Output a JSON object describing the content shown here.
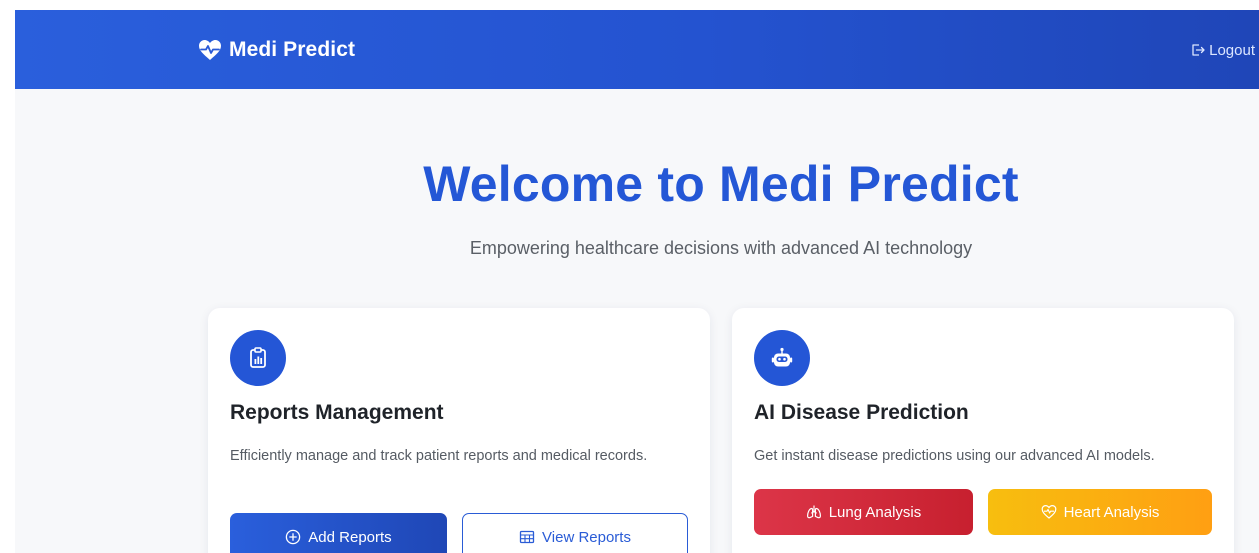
{
  "navbar": {
    "brand": "Medi Predict",
    "brand_icon": "heart-pulse-icon",
    "logout_label": "Logout",
    "logout_icon": "logout-icon"
  },
  "hero": {
    "title": "Welcome to Medi Predict",
    "subtitle": "Empowering healthcare decisions with advanced AI technology"
  },
  "cards": [
    {
      "icon": "clipboard-chart-icon",
      "title": "Reports Management",
      "description": "Efficiently manage and track patient reports and medical records.",
      "buttons": [
        {
          "label": "Add Reports",
          "icon": "plus-circle-icon"
        },
        {
          "label": "View Reports",
          "icon": "table-icon"
        }
      ]
    },
    {
      "icon": "robot-icon",
      "title": "AI Disease Prediction",
      "description": "Get instant disease predictions using our advanced AI models.",
      "buttons": [
        {
          "label": "Lung Analysis",
          "icon": "lungs-icon"
        },
        {
          "label": "Heart Analysis",
          "icon": "heart-pulse-icon"
        }
      ]
    }
  ],
  "colors": {
    "primary": "#2457d6",
    "danger": "#dc3548",
    "warning": "#f7be0f",
    "background": "#f7f8fa"
  }
}
